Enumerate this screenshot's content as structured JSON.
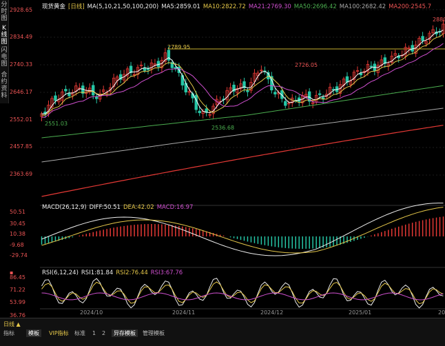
{
  "left_tabs": [
    "分时图",
    "K线图",
    "闪电图",
    "合约资料"
  ],
  "header": {
    "title": "现货黄金",
    "period": "[日线]",
    "ma_label": "MA(5,10,21,50,100,200)",
    "ma5": "MA5:2859.01",
    "ma10": "MA10:2822.72",
    "ma21": "MA21:2769.30",
    "ma50": "MA50:2696.42",
    "ma100": "MA100:2682.42",
    "ma200": "MA200:2545.7"
  },
  "price_axis": [
    "2928.65",
    "2834.49",
    "2740.33",
    "2646.17",
    "2552.01",
    "2457.85",
    "2363.69"
  ],
  "annotations": {
    "high1": "2789.95",
    "high2": "2726.05",
    "low1": "2551.03",
    "low2": "2536.68",
    "high3": "2880"
  },
  "macd": {
    "label": "MACD(26,12,9)",
    "diff": "DIFF:50.51",
    "dea": "DEA:42.02",
    "macd": "MACD:16.97",
    "axis": [
      "50.51",
      "30.45",
      "10.38",
      "-9.68",
      "-29.74"
    ]
  },
  "rsi": {
    "label": "RSI(6,12,24)",
    "rsi1": "RSI1:81.84",
    "rsi2": "RSI2:76.44",
    "rsi3": "RSI3:67.76",
    "axis": [
      "86.45",
      "71.22",
      "53.99",
      "36.76"
    ]
  },
  "dates": [
    "2024/10",
    "2024/11",
    "2024/12",
    "2025/01",
    "20"
  ],
  "bottom": {
    "period": "日线 ▲",
    "tabs": [
      "指标",
      "模板",
      "VIP指标",
      "标准",
      "1",
      "2",
      "异存模板",
      "管理模板"
    ]
  },
  "colors": {
    "up": "#e53935",
    "down": "#26c6a6",
    "ma5": "#ffffff",
    "ma10": "#e6c84a",
    "ma21": "#d050d0",
    "ma50": "#4caf50",
    "ma100": "#aaaaaa",
    "ma200": "#e53935"
  }
}
